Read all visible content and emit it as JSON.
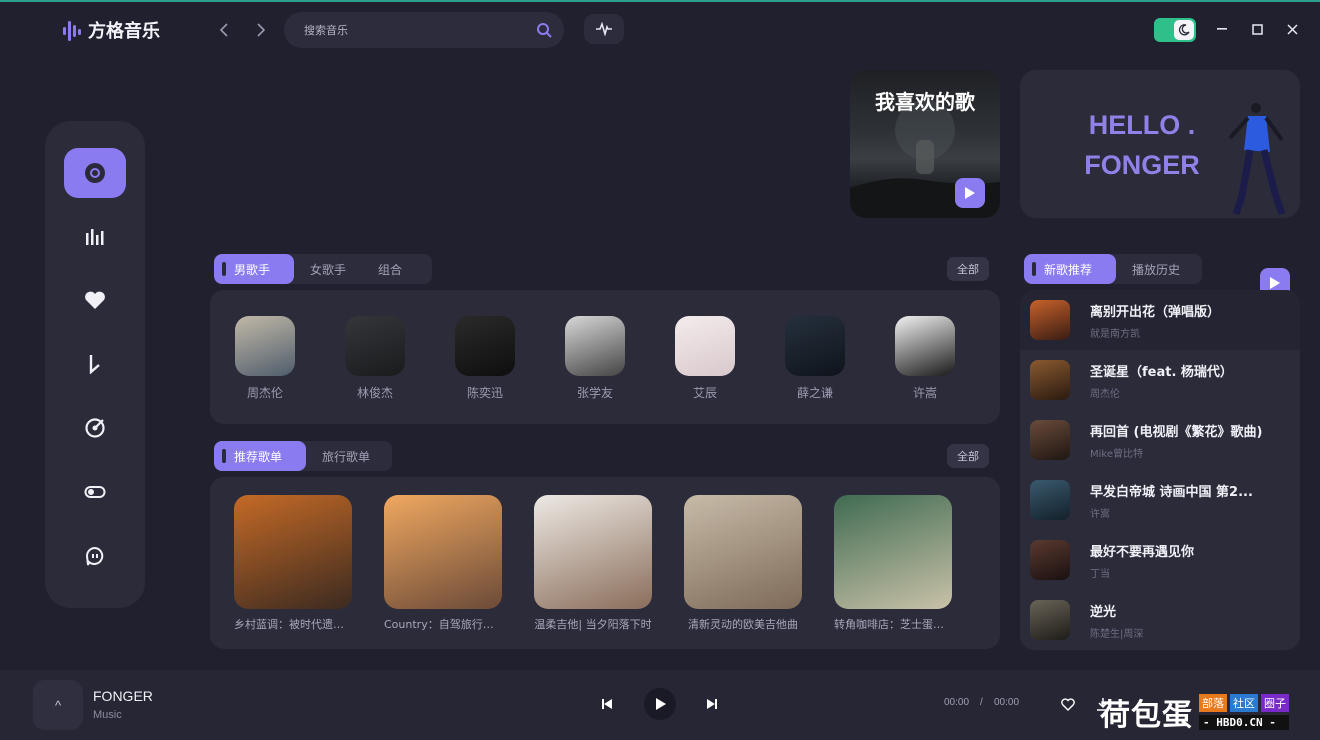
{
  "app": {
    "title": "方格音乐"
  },
  "search": {
    "placeholder": "搜索音乐"
  },
  "window": {
    "toggle_state": "dark"
  },
  "favorite": {
    "title": "我喜欢的歌"
  },
  "hello": {
    "line1": "HELLO .",
    "line2": "FONGER"
  },
  "singer_tabs": {
    "tabs": [
      "男歌手",
      "女歌手",
      "组合"
    ],
    "all": "全部"
  },
  "artists": [
    {
      "name": "周杰伦",
      "color1": "#c2b9a8",
      "color2": "#4f5d6c"
    },
    {
      "name": "林俊杰",
      "color1": "#34363a",
      "color2": "#1a1b1d"
    },
    {
      "name": "陈奕迅",
      "color1": "#2a2a2a",
      "color2": "#0e0e0e"
    },
    {
      "name": "张学友",
      "color1": "#d8d8d8",
      "color2": "#444"
    },
    {
      "name": "艾辰",
      "color1": "#f4ecec",
      "color2": "#d8c8cc"
    },
    {
      "name": "薛之谦",
      "color1": "#25303d",
      "color2": "#0f141b"
    },
    {
      "name": "许嵩",
      "color1": "#f2f2f2",
      "color2": "#1a1a1a"
    }
  ],
  "playlist_tabs": {
    "tabs": [
      "推荐歌单",
      "旅行歌单"
    ],
    "all": "全部"
  },
  "playlists": [
    {
      "name": "乡村蓝调：被时代遗忘的声音",
      "color1": "#c56a26",
      "color2": "#3b2a20"
    },
    {
      "name": "Country：自驾旅行必备",
      "color1": "#f0a860",
      "color2": "#6b4a38"
    },
    {
      "name": "温柔吉他| 当夕阳落下时",
      "color1": "#ede9e4",
      "color2": "#8a6d5a"
    },
    {
      "name": "清新灵动的欧美吉他曲",
      "color1": "#c7bba8",
      "color2": "#7e6a58"
    },
    {
      "name": "转角咖啡店：芝士蛋糕的味道",
      "color1": "#3f6b52",
      "color2": "#c9c2a8"
    }
  ],
  "song_tabs": {
    "tabs": [
      "新歌推荐",
      "播放历史"
    ]
  },
  "songs": [
    {
      "title": "离别开出花（弹唱版）",
      "artist": "就是南方凯",
      "color1": "#c7622a",
      "color2": "#3a1c14"
    },
    {
      "title": "圣诞星（feat. 杨瑞代）",
      "artist": "周杰伦",
      "color1": "#8a5a30",
      "color2": "#2a1a10"
    },
    {
      "title": "再回首 (电视剧《繁花》歌曲)",
      "artist": "Mike曾比特",
      "color1": "#6a4b3a",
      "color2": "#1f1612"
    },
    {
      "title": "早发白帝城 诗画中国 第2...",
      "artist": "许嵩",
      "color1": "#3a5a6e",
      "color2": "#13202a"
    },
    {
      "title": "最好不要再遇见你",
      "artist": "丁当",
      "color1": "#5a3a30",
      "color2": "#1a1010"
    },
    {
      "title": "逆光",
      "artist": "陈楚生|周深",
      "color1": "#6a6458",
      "color2": "#1e1c18"
    }
  ],
  "player": {
    "title": "FONGER",
    "artist": "Music",
    "cover_label": "^",
    "current": "00:00",
    "separator": "/",
    "duration": "00:00"
  },
  "watermark": {
    "text": "荷包蛋",
    "tag1": "部落",
    "tag2": "社区",
    "tag3": "圈子",
    "url": "- HBD0.CN -"
  }
}
